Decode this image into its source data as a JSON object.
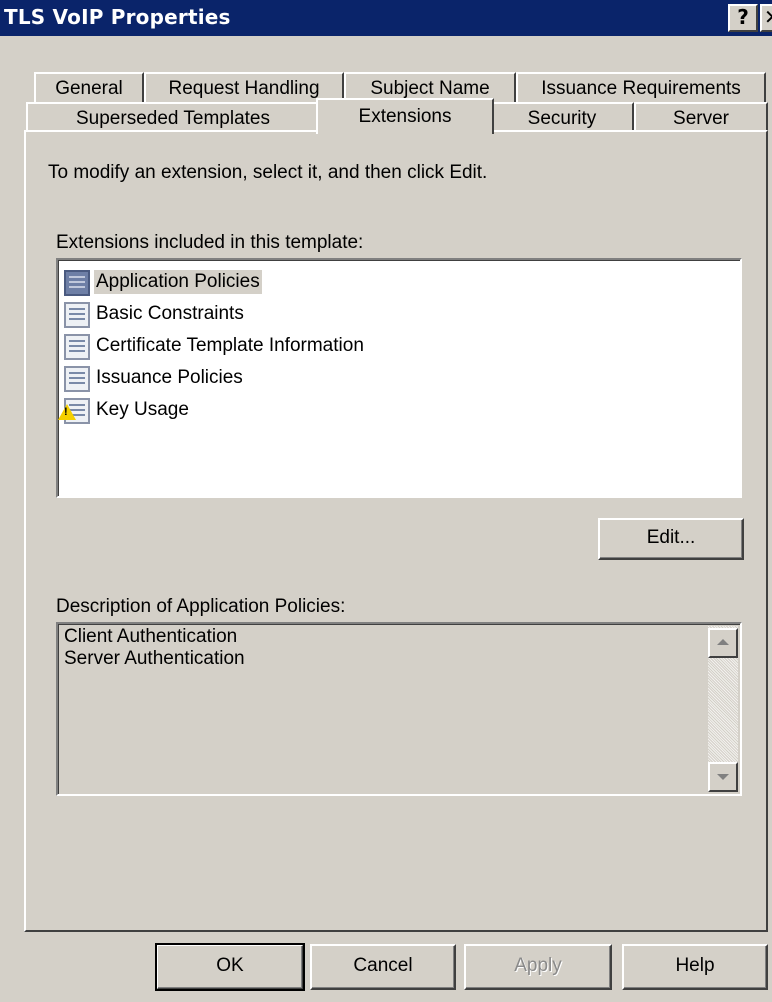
{
  "window": {
    "title": "TLS VoIP Properties",
    "help_glyph": "?",
    "close_glyph": "✕"
  },
  "tabs": {
    "row1": [
      "General",
      "Request Handling",
      "Subject Name",
      "Issuance Requirements"
    ],
    "row2": [
      "Superseded Templates",
      "Extensions",
      "Security",
      "Server"
    ],
    "active": "Extensions"
  },
  "panel": {
    "instruction": "To modify an extension, select it, and then click Edit.",
    "list_label": "Extensions included in this template:",
    "extensions": [
      {
        "label": "Application Policies",
        "selected": true,
        "warning": false
      },
      {
        "label": "Basic Constraints",
        "selected": false,
        "warning": false
      },
      {
        "label": "Certificate Template Information",
        "selected": false,
        "warning": false
      },
      {
        "label": "Issuance Policies",
        "selected": false,
        "warning": false
      },
      {
        "label": "Key Usage",
        "selected": false,
        "warning": true
      }
    ],
    "edit_label": "Edit...",
    "description_label": "Description of Application Policies:",
    "description_lines": [
      "Client Authentication",
      "Server Authentication"
    ]
  },
  "footer": {
    "ok_label": "OK",
    "cancel_label": "Cancel",
    "apply_label": "Apply",
    "help_label": "Help"
  },
  "colors": {
    "titlebar": "#0a246a",
    "face": "#d4d0c8",
    "warning": "#f5d000"
  }
}
